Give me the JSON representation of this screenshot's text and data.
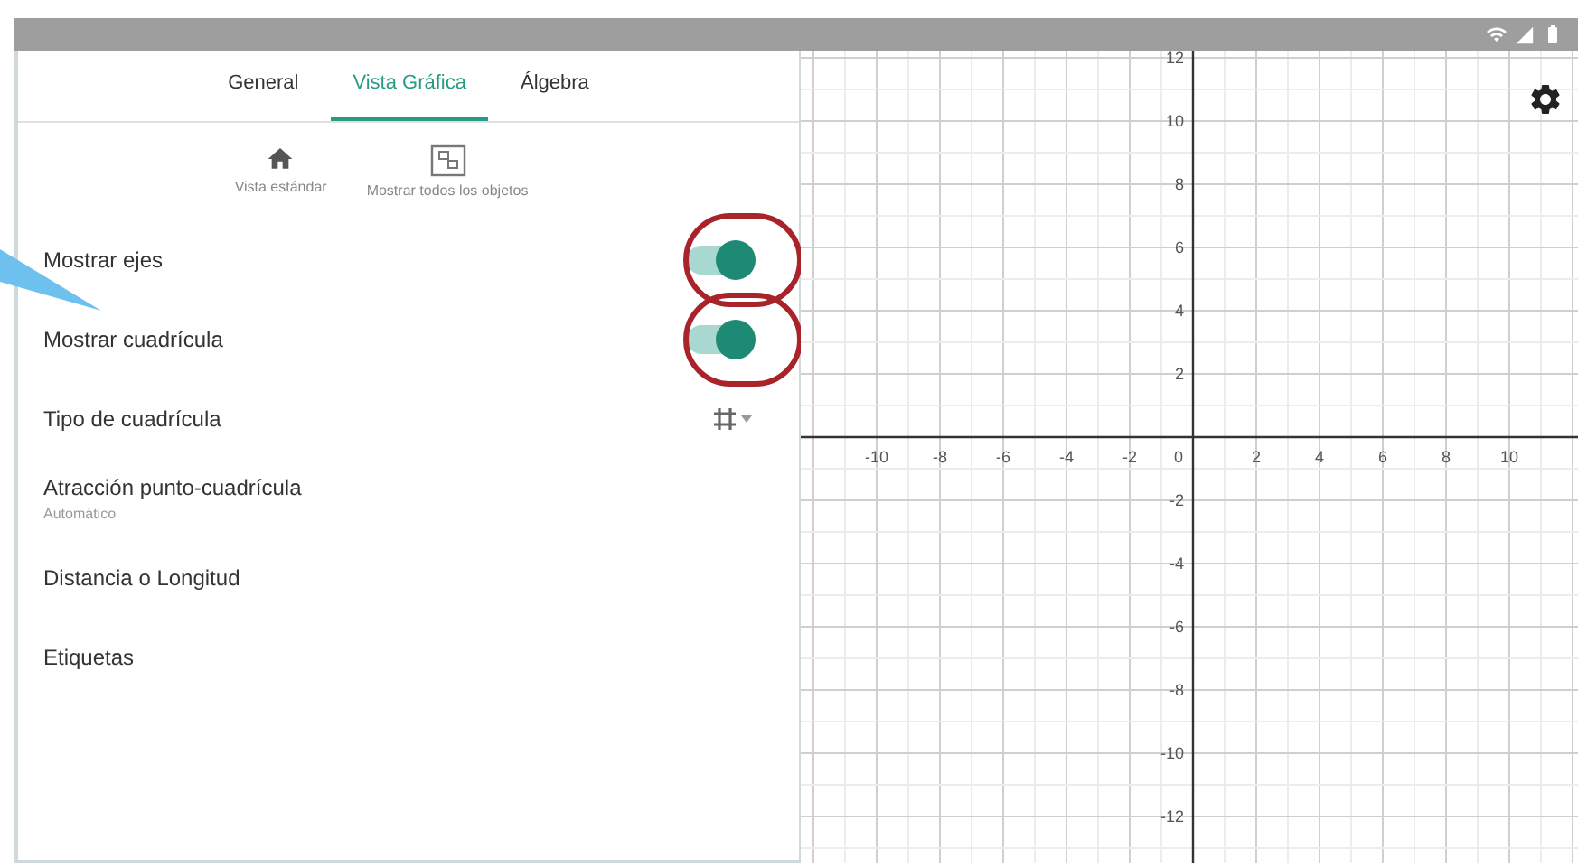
{
  "tabs": [
    {
      "label": "General",
      "selected": false
    },
    {
      "label": "Vista Gráfica",
      "selected": true
    },
    {
      "label": "Álgebra",
      "selected": false
    }
  ],
  "view_actions": [
    {
      "kind": "home",
      "label": "Vista estándar"
    },
    {
      "kind": "show_all",
      "label": "Mostrar todos los objetos"
    }
  ],
  "settings": [
    {
      "kind": "toggle",
      "label": "Mostrar ejes",
      "on": true,
      "highlighted": true
    },
    {
      "kind": "toggle",
      "label": "Mostrar cuadrícula",
      "on": true,
      "highlighted": true
    },
    {
      "kind": "grid_type",
      "label": "Tipo de cuadrícula"
    },
    {
      "kind": "option",
      "label": "Atracción punto-cuadrícula",
      "value": "Automático"
    },
    {
      "kind": "option",
      "label": "Distancia o Longitud"
    },
    {
      "kind": "option",
      "label": "Etiquetas"
    }
  ],
  "graphics_view": {
    "x_ticks_negative": [
      "-10",
      "-8",
      "-6",
      "-4",
      "-2"
    ],
    "origin": "0",
    "x_ticks_positive": [
      "2",
      "4",
      "6",
      "8",
      "10"
    ],
    "y_ticks_positive": [
      "12",
      "10",
      "8",
      "6",
      "4",
      "2"
    ],
    "y_ticks_negative": [
      "-2",
      "-4",
      "-6",
      "-8",
      "-10",
      "-12"
    ]
  }
}
